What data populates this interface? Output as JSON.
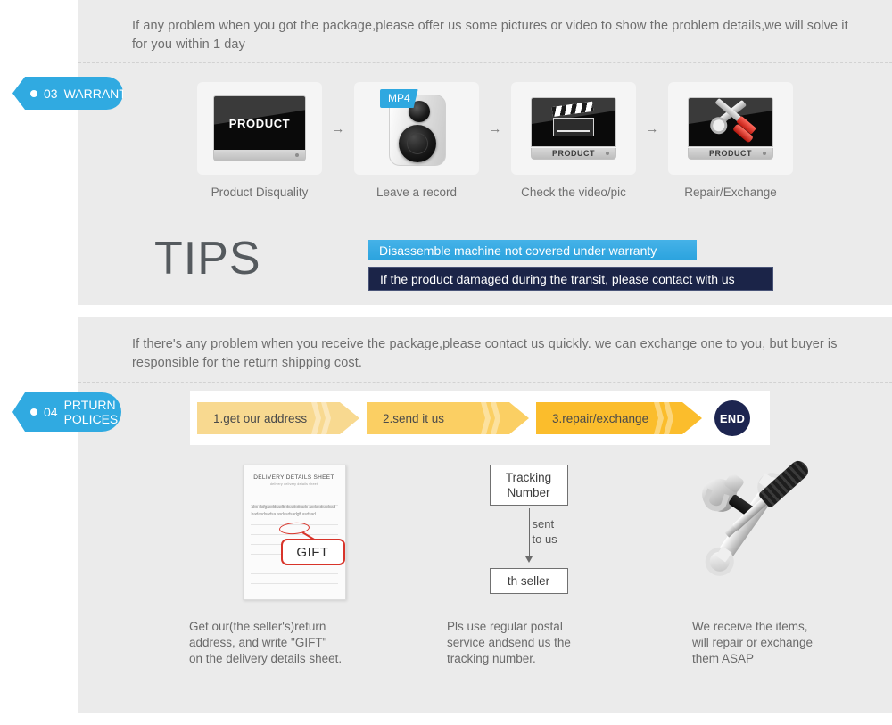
{
  "warranty": {
    "tag": {
      "number": "03",
      "label": "WARRANTY"
    },
    "intro": "If any problem when you got the package,please offer us some pictures or video to show the problem details,we will solve it for you within 1 day",
    "steps": [
      {
        "caption": "Product Disquality",
        "screen_text": "PRODUCT",
        "icon": "monitor-product-icon"
      },
      {
        "caption": "Leave a record",
        "badge": "MP4",
        "icon": "camera-recorder-icon"
      },
      {
        "caption": "Check the video/pic",
        "base_label": "PRODUCT",
        "icon": "clapperboard-monitor-icon"
      },
      {
        "caption": "Repair/Exchange",
        "base_label": "PRODUCT",
        "icon": "tools-monitor-icon"
      }
    ],
    "step_arrow": "→",
    "tips": {
      "heading": "TIPS",
      "lines": [
        "Disassemble machine not covered under warranty",
        "If the product damaged during the transit, please contact with us"
      ]
    }
  },
  "returns": {
    "tag": {
      "number": "04",
      "label": "PRTURN\nPOLICES"
    },
    "intro": "If  there's any problem when you receive the package,please contact us quickly. we can exchange one to you, but buyer is responsible for the return shipping cost.",
    "steps": [
      {
        "label": "1.get our address"
      },
      {
        "label": "2.send it us"
      },
      {
        "label": "3.repair/exchange"
      }
    ],
    "end_label": "END",
    "columns": [
      {
        "icon": "delivery-details-sheet-icon",
        "sheet_title": "DELIVERY DETAILS SHEET",
        "sheet_subtitle": "delivery        delivery details sheet",
        "sheet_body": "abc dafgasddsadb dsadsdsads asdasdsadsadbadasdsadsa asdasdsadgft asdsad",
        "bubble": "GIFT",
        "caption": "Get our(the seller's)return\naddress, and write \"GIFT\"\non the delivery details sheet."
      },
      {
        "icon": "tracking-flow-icon",
        "box_top": "Tracking\nNumber",
        "arrow_label": "sent\nto us",
        "box_bottom": "th seller",
        "caption": "Pls use regular postal\nservice andsend us the\n tracking number."
      },
      {
        "icon": "hammer-wrench-screwdriver-icon",
        "caption": "We receive the items,\nwill repair or exchange\n them ASAP"
      }
    ]
  },
  "colors": {
    "tag_blue": "#30aae1",
    "tip_blue": "#2ba3de",
    "tip_navy": "#1b2448",
    "chevron_light": "#f8d990",
    "chevron_mid": "#fbcf63",
    "chevron_dark": "#fbbd2c",
    "end_navy": "#1d2550",
    "panel_gray": "#ebebeb"
  }
}
